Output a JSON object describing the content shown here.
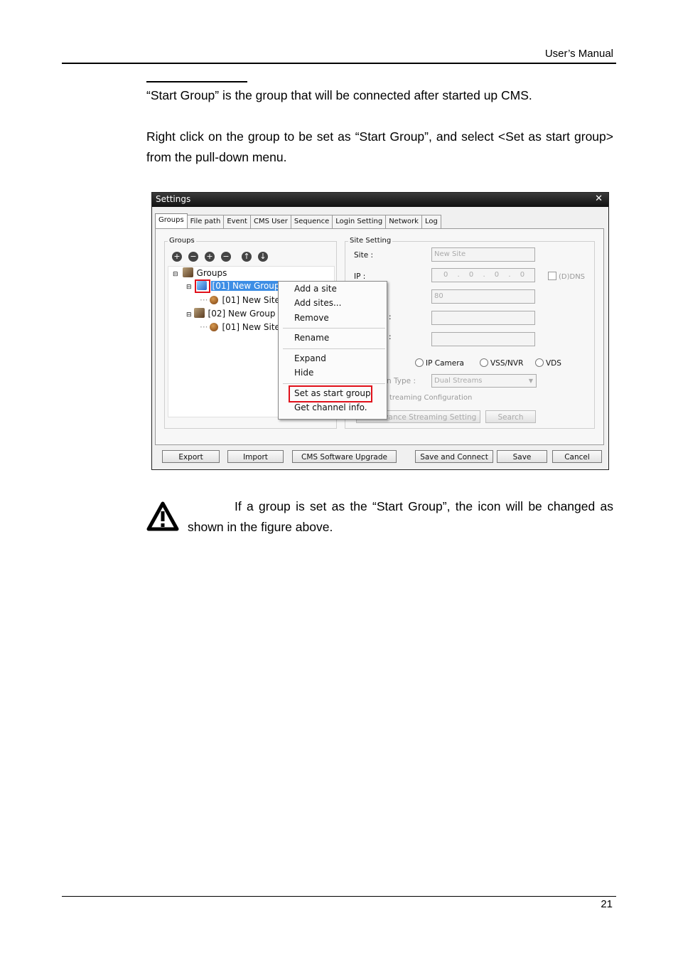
{
  "header": {
    "title": "User’s Manual"
  },
  "body": {
    "p1": "“Start Group” is the group that will be connected after started up CMS.",
    "p2": "Right click on the group to be set as “Start Group”, and select <Set as start group> from the pull-down menu.",
    "note": "If a group is set as the “Start Group”, the icon will be changed as shown in the figure above."
  },
  "screenshot": {
    "window_title": "Settings",
    "tabs": [
      "Groups",
      "File path",
      "Event",
      "CMS User",
      "Sequence",
      "Login Setting",
      "Network",
      "Log"
    ],
    "groups_legend": "Groups",
    "tree": {
      "root": "Groups",
      "group1": "[01] New Group",
      "group1_site": "[01] New Site",
      "group2": "[02] New Group",
      "group2_site": "[01] New Site"
    },
    "site_setting": {
      "legend": "Site Setting",
      "site_label": "Site :",
      "site_value": "New Site",
      "ip_label": "IP :",
      "ip_value": "0 . 0 . 0 . 0",
      "ddns": "(D)DNS",
      "port_value": "80",
      "radio_ip_camera": "IP Camera",
      "radio_vss_nvr": "VSS/NVR",
      "radio_vds": "VDS",
      "type_label": "n Type :",
      "type_value": "Dual Streams",
      "streaming_config": "treaming Configuration",
      "advance_btn": "Advance Streaming Setting",
      "search_btn": "Search"
    },
    "context_menu": {
      "items": [
        "Add a site",
        "Add sites...",
        "Remove",
        "Rename",
        "Expand",
        "Hide",
        "Set as start group",
        "Get channel info."
      ]
    },
    "bottom_buttons": [
      "Export",
      "Import",
      "CMS Software Upgrade",
      "Save and Connect",
      "Save",
      "Cancel"
    ]
  },
  "footer": {
    "page_number": "21"
  }
}
